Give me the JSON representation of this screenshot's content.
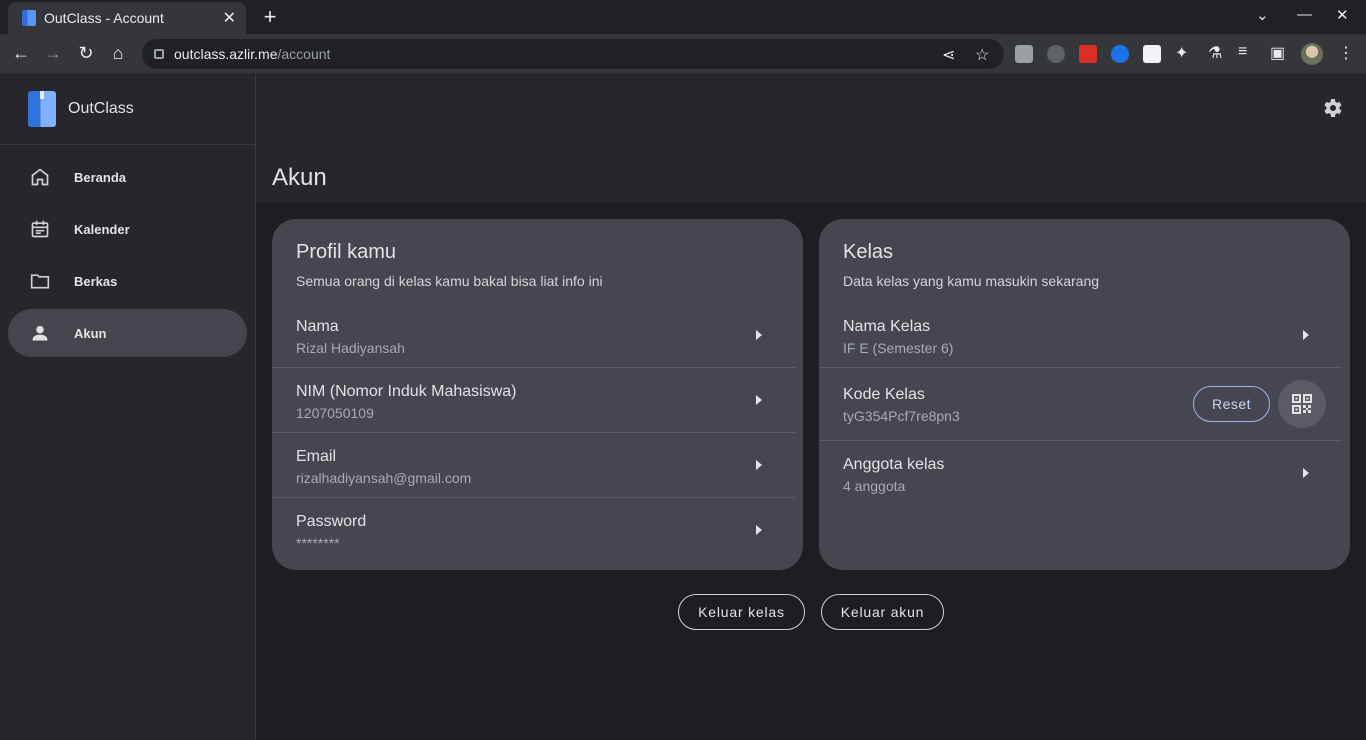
{
  "browser": {
    "tab_title": "OutClass - Account",
    "url_host": "outclass.azlir.me",
    "url_path": "/account"
  },
  "sidebar": {
    "brand": "OutClass",
    "items": [
      {
        "label": "Beranda",
        "icon": "home-icon"
      },
      {
        "label": "Kalender",
        "icon": "calendar-icon"
      },
      {
        "label": "Berkas",
        "icon": "folder-icon"
      },
      {
        "label": "Akun",
        "icon": "person-icon",
        "active": true
      }
    ]
  },
  "page": {
    "title": "Akun"
  },
  "profile": {
    "title": "Profil kamu",
    "subtitle": "Semua orang di kelas kamu bakal bisa liat info ini",
    "rows": [
      {
        "key": "Nama",
        "value": "Rizal Hadiyansah"
      },
      {
        "key": "NIM (Nomor Induk Mahasiswa)",
        "value": "1207050109"
      },
      {
        "key": "Email",
        "value": "rizalhadiyansah@gmail.com"
      },
      {
        "key": "Password",
        "value": "********"
      }
    ]
  },
  "kelas": {
    "title": "Kelas",
    "subtitle": "Data kelas yang kamu masukin sekarang",
    "rows": [
      {
        "key": "Nama Kelas",
        "value": "IF E (Semester 6)"
      },
      {
        "key": "Kode Kelas",
        "value": "tyG354Pcf7re8pn3"
      },
      {
        "key": "Anggota kelas",
        "value": "4 anggota"
      }
    ],
    "reset_label": "Reset"
  },
  "actions": {
    "leave_class": "Keluar kelas",
    "logout": "Keluar akun"
  },
  "colors": {
    "accent": "#9eb7e8",
    "card": "#45464f",
    "sidebar": "#26272c"
  }
}
